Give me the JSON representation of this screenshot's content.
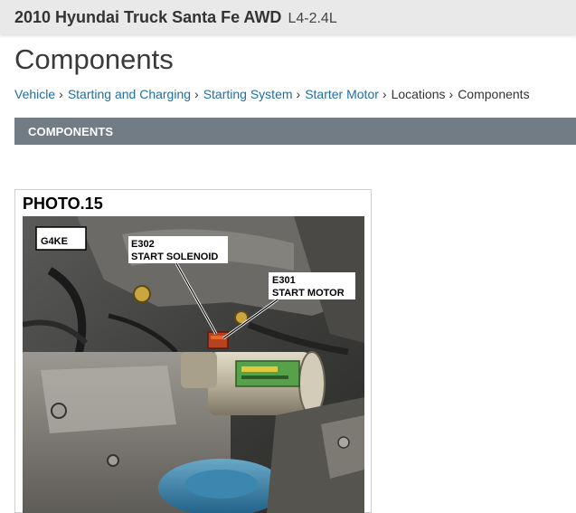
{
  "header": {
    "vehicle": "2010 Hyundai Truck Santa Fe AWD",
    "engine": "L4-2.4L"
  },
  "page": {
    "title": "Components"
  },
  "breadcrumb": {
    "items": [
      {
        "label": "Vehicle",
        "link": true
      },
      {
        "label": "Starting and Charging",
        "link": true
      },
      {
        "label": "Starting System",
        "link": true
      },
      {
        "label": "Starter Motor",
        "link": true
      },
      {
        "label": "Locations",
        "link": false
      },
      {
        "label": "Components",
        "link": false
      }
    ],
    "separator": "›"
  },
  "section": {
    "title": "COMPONENTS"
  },
  "figure": {
    "photo_label": "PHOTO.15",
    "engine_code": "G4KE",
    "callouts": [
      {
        "code": "E302",
        "text": "START SOLENOID"
      },
      {
        "code": "E301",
        "text": "START MOTOR"
      }
    ]
  }
}
